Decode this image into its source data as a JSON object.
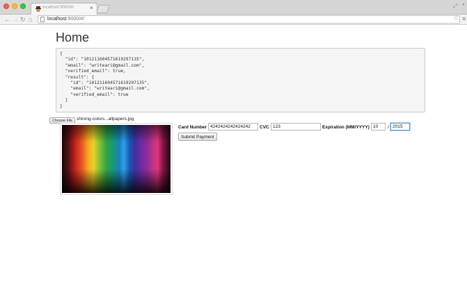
{
  "browser": {
    "tab_title": "localhost:9000/#/",
    "tab_close": "×",
    "url_host": "localhost",
    "url_rest": ":9000/#/",
    "icons": {
      "back": "back-arrow-icon",
      "forward": "forward-arrow-icon",
      "reload": "reload-icon",
      "home": "home-icon",
      "bookmark": "star-icon",
      "menu": "hamburger-menu-icon"
    }
  },
  "page": {
    "title": "Home",
    "json_output": "{\n  \"id\": \"101211604571619297135\",\n  \"email\": \"writeari@gmail.com\",\n  \"verified_email\": true,\n  \"result\": {\n    \"id\": \"101211604571619297135\",\n    \"email\": \"writeari@gmail.com\",\n    \"verified_email\": true\n  }\n}"
  },
  "upload": {
    "choose_label": "Choose File",
    "file_name": "shining-colors...allpapers.jpg"
  },
  "payment": {
    "card_label": "Card Number",
    "card_value": "4242424242424242",
    "cvc_label": "CVC",
    "cvc_value": "123",
    "exp_label": "Expiration (MM/YYYY)",
    "exp_month": "10",
    "exp_sep": "/",
    "exp_year": "2015",
    "submit_label": "Submit Payment"
  }
}
